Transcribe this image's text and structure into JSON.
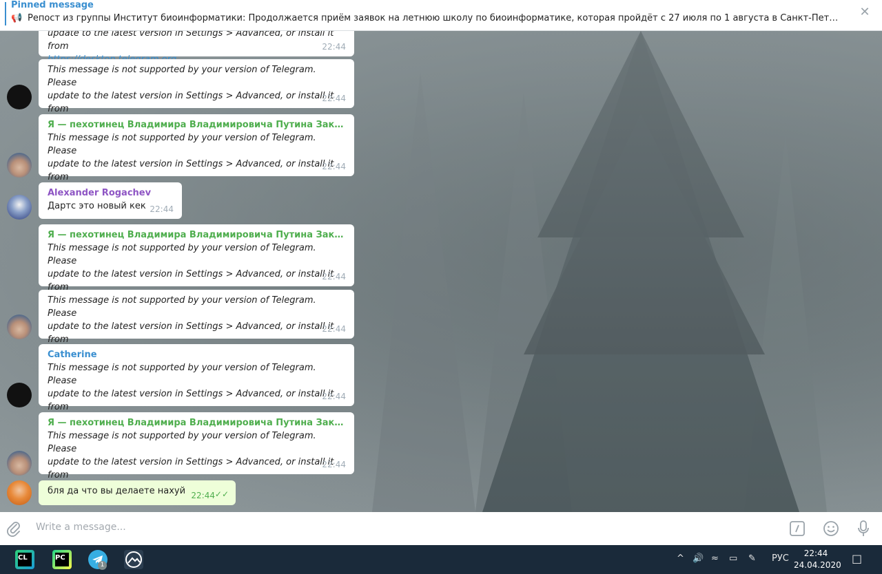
{
  "pinned": {
    "title": "Pinned message",
    "text": "Репост из группы Институт биоинформатики: Продолжается приём заявок на летнюю школу по биоинформатике, которая пройдёт с 27 июля по 1 августа в Санкт-Петербурге..."
  },
  "unsupported": {
    "line1": "This message is not supported by your version of Telegram. Please",
    "line2": "update to the latest version in Settings > Advanced, or install it from",
    "link": "https://desktop.telegram.org"
  },
  "messages": [
    {
      "time": "22:44"
    },
    {
      "time": "22:44"
    },
    {
      "sender": "Я — пехотинец Владимира Владимировича Путина Законно...",
      "time": "22:44"
    },
    {
      "sender": "Alexander Rogachev",
      "text": "Дартс это новый кек",
      "time": "22:44"
    },
    {
      "sender": "Я — пехотинец Владимира Владимировича Путина Законно...",
      "time": "22:44"
    },
    {
      "time": "22:44"
    },
    {
      "sender": "Catherine",
      "time": "22:44"
    },
    {
      "sender": "Я — пехотинец Владимира Владимировича Путина Законно...",
      "time": "22:44"
    },
    {
      "text": "бля да что вы делаете нахуй",
      "time": "22:44"
    }
  ],
  "composer": {
    "placeholder": "Write a message..."
  },
  "taskbar": {
    "apps": [
      {
        "label": "CL",
        "icon": "clion-icon"
      },
      {
        "label": "PC",
        "icon": "pycharm-icon"
      },
      {
        "label": "1",
        "icon": "telegram-icon"
      },
      {
        "icon": "photos-icon"
      }
    ],
    "lang": "РУС",
    "time": "22:44",
    "date": "24.04.2020"
  }
}
